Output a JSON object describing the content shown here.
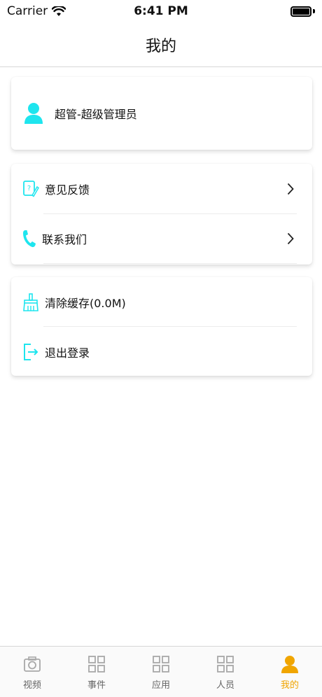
{
  "status_bar": {
    "carrier": "Carrier",
    "time": "6:41 PM"
  },
  "nav": {
    "title": "我的"
  },
  "profile": {
    "name": "超管-超级管理员",
    "icon": "user-icon"
  },
  "menu_group_1": [
    {
      "label": "意见反馈",
      "icon": "feedback-icon"
    },
    {
      "label": "联系我们",
      "icon": "phone-icon"
    }
  ],
  "menu_group_2": [
    {
      "label": "清除缓存(0.0M)",
      "icon": "broom-icon"
    },
    {
      "label": "退出登录",
      "icon": "logout-icon"
    }
  ],
  "tabs": [
    {
      "label": "视频",
      "icon": "camera-icon",
      "active": false
    },
    {
      "label": "事件",
      "icon": "grid-icon",
      "active": false
    },
    {
      "label": "应用",
      "icon": "grid-icon",
      "active": false
    },
    {
      "label": "人员",
      "icon": "grid-icon",
      "active": false
    },
    {
      "label": "我的",
      "icon": "user-icon",
      "active": true
    }
  ],
  "colors": {
    "accent_cyan": "#1ee5ee",
    "tab_active": "#f0a500",
    "tab_inactive": "#a8a8a8"
  }
}
